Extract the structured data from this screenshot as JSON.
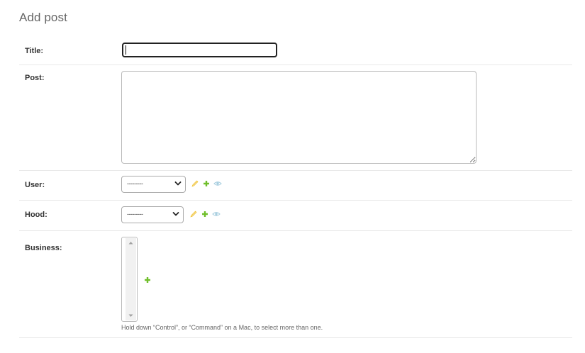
{
  "page": {
    "title": "Add post"
  },
  "form": {
    "title_field": {
      "label": "Title:",
      "value": ""
    },
    "post_field": {
      "label": "Post:",
      "value": ""
    },
    "user_field": {
      "label": "User:",
      "selected": "---------",
      "icons": [
        "pencil-icon",
        "plus-icon",
        "eye-icon"
      ]
    },
    "hood_field": {
      "label": "Hood:",
      "selected": "---------",
      "icons": [
        "pencil-icon",
        "plus-icon",
        "eye-icon"
      ]
    },
    "business_field": {
      "label": "Business:",
      "help": "Hold down “Control”, or “Command” on a Mac, to select more than one.",
      "icons": [
        "plus-icon"
      ]
    }
  },
  "colors": {
    "add_icon": "#70bf2b",
    "change_icon": "#efb80b",
    "view_icon": "#79aec8",
    "border": "#bbbbbb",
    "focused_border": "#222222"
  }
}
